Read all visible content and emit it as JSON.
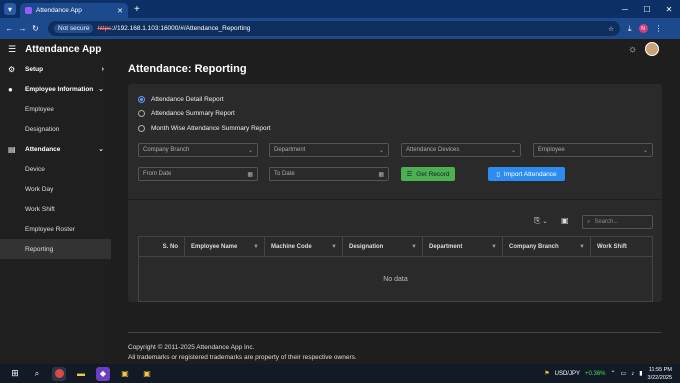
{
  "browser": {
    "tab_title": "Attendance App",
    "new_tab": "+",
    "security": "Not secure",
    "url_scheme": "https",
    "url_rest": "://192.168.1.103:16000/#/Attendance_Reporting",
    "profile_initial": "N"
  },
  "sidebar": {
    "app_title": "Attendance App",
    "items": [
      {
        "label": "Setup"
      },
      {
        "label": "Employee Information"
      },
      {
        "label": "Employee"
      },
      {
        "label": "Designation"
      },
      {
        "label": "Attendance"
      },
      {
        "label": "Device"
      },
      {
        "label": "Work Day"
      },
      {
        "label": "Work Shift"
      },
      {
        "label": "Employee Roster"
      },
      {
        "label": "Reporting"
      }
    ]
  },
  "page": {
    "title": "Attendance: Reporting",
    "report_options": [
      "Attendance Detail Report",
      "Attendance Summary Report",
      "Month Wise Attendance Summary Report"
    ],
    "selected_option": "Attendance Detail Report",
    "filters": {
      "company_branch": "Company Branch",
      "department": "Department",
      "attendance_devices": "Attendance Devices",
      "employee": "Employee",
      "from_date": "From Date",
      "to_date": "To Date"
    },
    "buttons": {
      "get_record": "Get Record",
      "import_attendance": "Import Attendance"
    },
    "search_placeholder": "Search...",
    "columns": [
      "S. No",
      "Employee Name",
      "Machine Code",
      "Designation",
      "Department",
      "Company Branch",
      "Work Shift"
    ],
    "no_data": "No data",
    "footer_line1": "Copyright © 2011-2025 Attendance App Inc.",
    "footer_line2": "All trademarks or registered trademarks are property of their respective owners."
  },
  "taskbar": {
    "ticker": "USD/JPY",
    "ticker_change": "+0.36%",
    "time": "11:55 PM",
    "date": "3/22/2025"
  },
  "colors": {
    "accent": "#2d8cf0",
    "green": "#4caf50",
    "browser_blue": "#1c4a8c"
  }
}
